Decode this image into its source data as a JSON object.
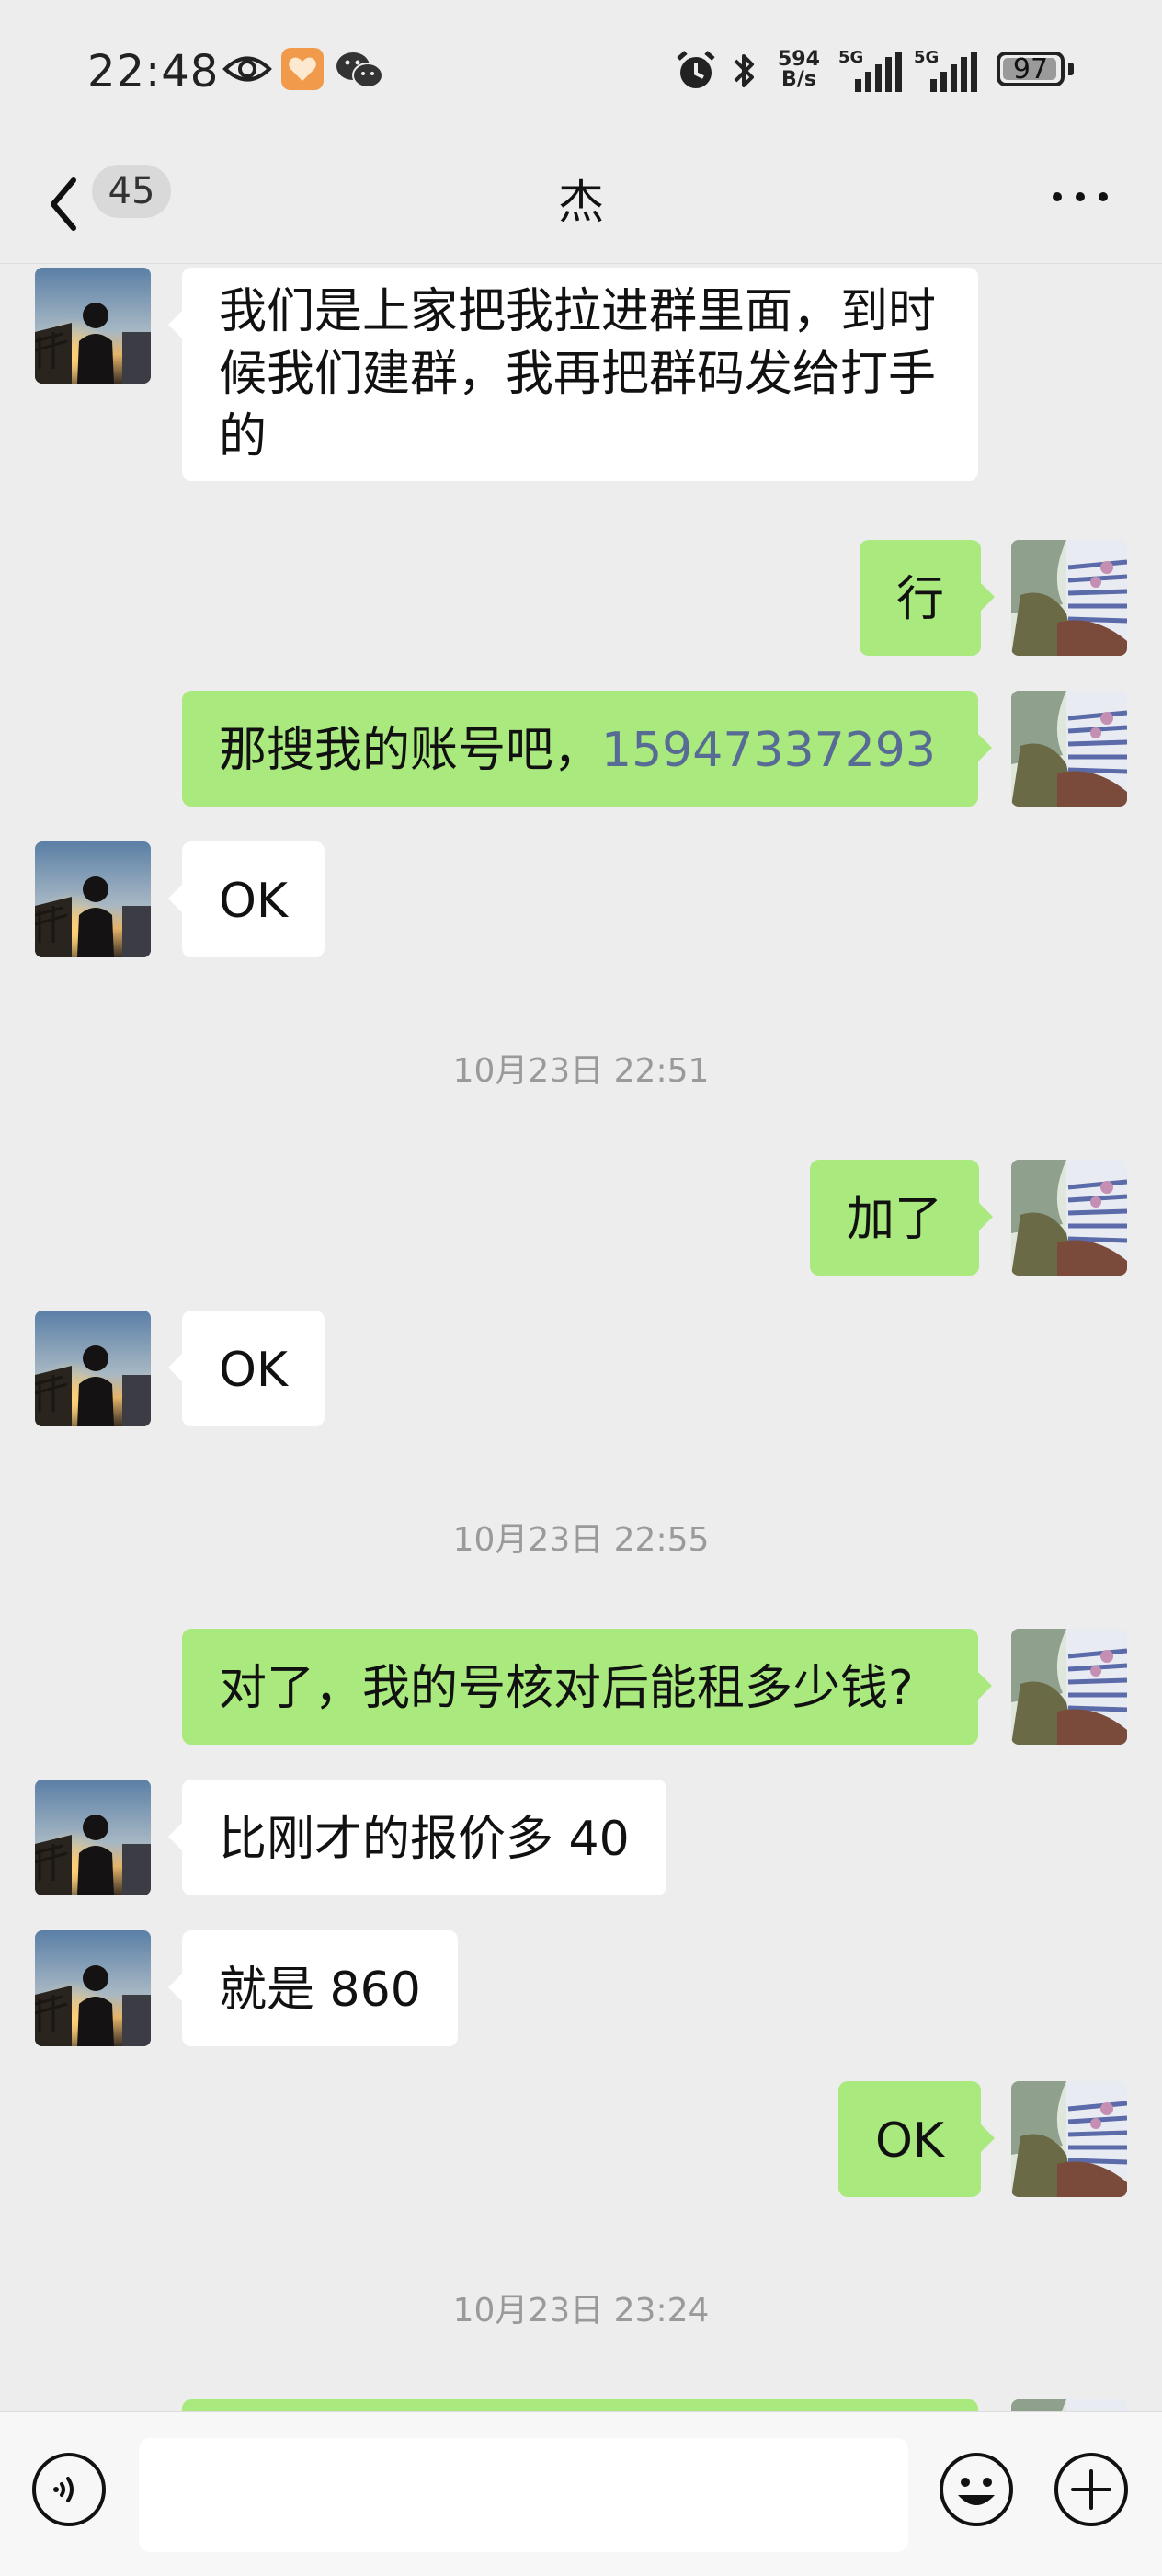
{
  "status_bar": {
    "time": "22:48",
    "net_speed_value": "594",
    "net_speed_unit": "B/s",
    "sim1_label": "5G",
    "sim2_label": "5G",
    "battery": "97",
    "icons": [
      "eye-icon",
      "health-app-icon",
      "wechat-icon",
      "alarm-icon",
      "bluetooth-icon",
      "signal-icon",
      "battery-icon"
    ]
  },
  "nav": {
    "unread_count": "45",
    "title": "杰",
    "more_icon": "more-icon"
  },
  "messages": [
    {
      "side": "in",
      "text": "我们是上家把我拉进群里面，到时候我们建群，我再把群码发给打手的"
    },
    {
      "side": "out",
      "text": "行"
    },
    {
      "side": "out",
      "text_prefix": "那搜我的账号吧，",
      "phone": "15947337293"
    },
    {
      "side": "in",
      "text": "OK"
    },
    {
      "side": "time",
      "text": "10月23日 22:51"
    },
    {
      "side": "out",
      "text": "加了"
    },
    {
      "side": "in",
      "text": "OK"
    },
    {
      "side": "time",
      "text": "10月23日 22:55"
    },
    {
      "side": "out",
      "text": "对了，我的号核对后能租多少钱?"
    },
    {
      "side": "in",
      "text": "比刚才的报价多 40"
    },
    {
      "side": "in",
      "text": "就是 860"
    },
    {
      "side": "out",
      "text": "OK"
    },
    {
      "side": "time",
      "text": "10月23日 23:24"
    }
  ],
  "input_bar": {
    "voice_icon": "voice-icon",
    "emoji_icon": "emoji-icon",
    "plus_icon": "plus-icon",
    "placeholder": ""
  },
  "colors": {
    "background": "#ededed",
    "incoming_bubble": "#ffffff",
    "outgoing_bubble": "#a9e97e",
    "link": "#576b95",
    "timestamp": "#9a9a9a"
  }
}
